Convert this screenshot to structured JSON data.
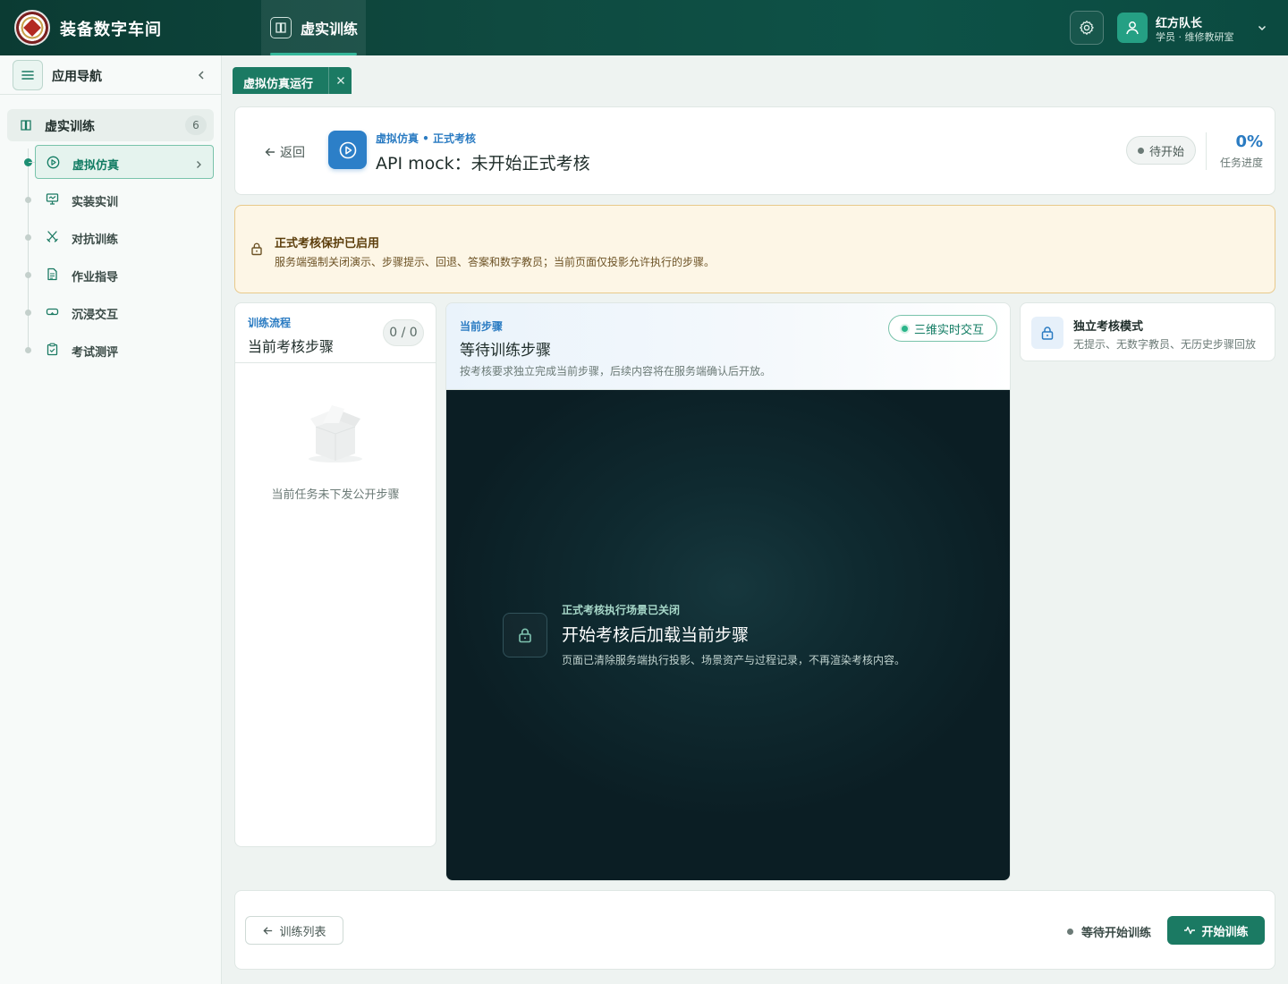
{
  "app": {
    "title": "装备数字车间"
  },
  "header": {
    "top_tab": {
      "label": "虚实训练",
      "icon": "book-icon"
    },
    "settings_icon": "gear-icon",
    "user": {
      "name": "红方队长",
      "role": "学员 · 维修教研室",
      "icon": "user-icon"
    }
  },
  "sidebar": {
    "title": "应用导航",
    "group": {
      "label": "虚实训练",
      "count": "6"
    },
    "items": [
      {
        "label": "虚拟仿真",
        "icon": "play-circle-icon",
        "active": true
      },
      {
        "label": "实装实训",
        "icon": "monitor-icon"
      },
      {
        "label": "对抗训练",
        "icon": "swords-icon"
      },
      {
        "label": "作业指导",
        "icon": "document-icon"
      },
      {
        "label": "沉浸交互",
        "icon": "vr-glasses-icon"
      },
      {
        "label": "考试测评",
        "icon": "clipboard-check-icon"
      }
    ]
  },
  "page_tab": {
    "label": "虚拟仿真运行"
  },
  "task_header": {
    "back_label": "返回",
    "breadcrumb": "虚拟仿真 • 正式考核",
    "title": "API mock：未开始正式考核",
    "status": "待开始",
    "progress_value": "0%",
    "progress_label": "任务进度"
  },
  "warning": {
    "title": "正式考核保护已启用",
    "text": "服务端强制关闭演示、步骤提示、回退、答案和数字教员；当前页面仅投影允许执行的步骤。"
  },
  "flow": {
    "subtitle": "训练流程",
    "title": "当前考核步骤",
    "count": "0 / 0",
    "empty_text": "当前任务未下发公开步骤"
  },
  "current_step": {
    "subtitle": "当前步骤",
    "title": "等待训练步骤",
    "description": "按考核要求独立完成当前步骤，后续内容将在服务端确认后开放。",
    "interact_label": "三维实时交互",
    "scene": {
      "subtitle": "正式考核执行场景已关闭",
      "title": "开始考核后加载当前步骤",
      "description": "页面已清除服务端执行投影、场景资产与过程记录，不再渲染考核内容。"
    }
  },
  "mode": {
    "title": "独立考核模式",
    "text": "无提示、无数字教员、无历史步骤回放"
  },
  "footer": {
    "list_button": "训练列表",
    "status": "等待开始训练",
    "start_button": "开始训练"
  },
  "colors": {
    "header_bg": "#0f4a40",
    "accent": "#1b7a63",
    "link_blue": "#2a7bc2",
    "warning_bg": "#fdf6e6",
    "scene_bg": "#0f2a30"
  }
}
